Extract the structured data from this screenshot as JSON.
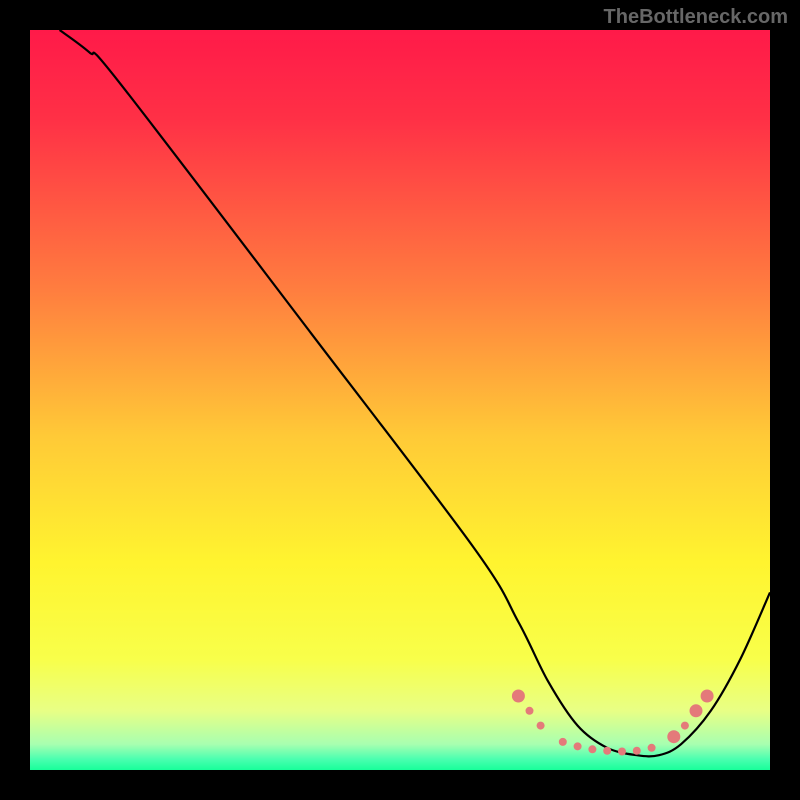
{
  "watermark": "TheBottleneck.com",
  "chart_data": {
    "type": "line",
    "title": "",
    "xlabel": "",
    "ylabel": "",
    "xlim": [
      0,
      100
    ],
    "ylim": [
      0,
      100
    ],
    "background_gradient": {
      "stops": [
        {
          "offset": 0.0,
          "color": "#ff1a49"
        },
        {
          "offset": 0.12,
          "color": "#ff3046"
        },
        {
          "offset": 0.35,
          "color": "#ff7d3f"
        },
        {
          "offset": 0.55,
          "color": "#ffca37"
        },
        {
          "offset": 0.72,
          "color": "#fff42f"
        },
        {
          "offset": 0.85,
          "color": "#f8ff4a"
        },
        {
          "offset": 0.92,
          "color": "#e8ff85"
        },
        {
          "offset": 0.965,
          "color": "#a8ffb0"
        },
        {
          "offset": 0.985,
          "color": "#4cffb0"
        },
        {
          "offset": 1.0,
          "color": "#18ff9a"
        }
      ]
    },
    "series": [
      {
        "name": "bottleneck-curve",
        "color": "#000000",
        "x": [
          4.0,
          8.0,
          12.0,
          38.0,
          60.0,
          66.0,
          70.0,
          74.0,
          78.0,
          82.0,
          85.0,
          88.0,
          92.0,
          96.0,
          100.0
        ],
        "values": [
          100.0,
          97.0,
          93.0,
          59.0,
          30.0,
          20.0,
          12.0,
          6.0,
          3.0,
          2.0,
          2.0,
          3.5,
          8.0,
          15.0,
          24.0
        ]
      }
    ],
    "markers": {
      "name": "highlighted-range",
      "color": "#e47a7a",
      "radius_small": 4.0,
      "radius_large": 6.5,
      "points": [
        {
          "x": 66.0,
          "y": 10.0,
          "r": "large"
        },
        {
          "x": 67.5,
          "y": 8.0,
          "r": "small"
        },
        {
          "x": 69.0,
          "y": 6.0,
          "r": "small"
        },
        {
          "x": 72.0,
          "y": 3.8,
          "r": "small"
        },
        {
          "x": 74.0,
          "y": 3.2,
          "r": "small"
        },
        {
          "x": 76.0,
          "y": 2.8,
          "r": "small"
        },
        {
          "x": 78.0,
          "y": 2.6,
          "r": "small"
        },
        {
          "x": 80.0,
          "y": 2.5,
          "r": "small"
        },
        {
          "x": 82.0,
          "y": 2.6,
          "r": "small"
        },
        {
          "x": 84.0,
          "y": 3.0,
          "r": "small"
        },
        {
          "x": 87.0,
          "y": 4.5,
          "r": "large"
        },
        {
          "x": 88.5,
          "y": 6.0,
          "r": "small"
        },
        {
          "x": 90.0,
          "y": 8.0,
          "r": "large"
        },
        {
          "x": 91.5,
          "y": 10.0,
          "r": "large"
        }
      ]
    }
  }
}
